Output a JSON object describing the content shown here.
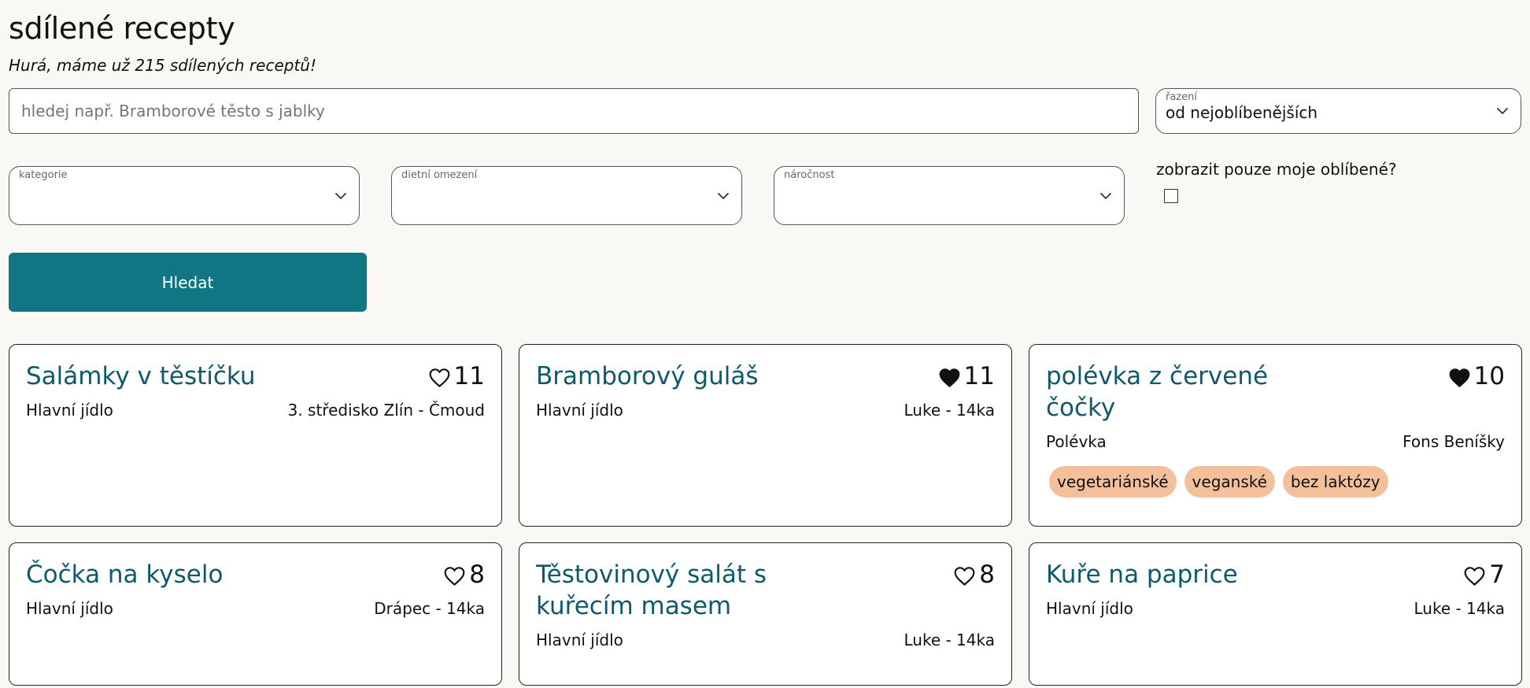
{
  "header": {
    "title": "sdílené recepty",
    "subtitle": "Hurá, máme už 215 sdílených receptů!"
  },
  "search": {
    "placeholder": "hledej např. Bramborové těsto s jablky",
    "value": ""
  },
  "sort": {
    "label": "řazení",
    "value": "od nejoblíbenějších"
  },
  "filters": {
    "category": {
      "label": "kategorie",
      "value": ""
    },
    "diet": {
      "label": "dietní omezení",
      "value": ""
    },
    "difficulty": {
      "label": "náročnost",
      "value": ""
    },
    "favorites_only": {
      "label": "zobrazit pouze moje oblíbené?",
      "checked": false
    }
  },
  "search_button": {
    "label": "Hledat"
  },
  "colors": {
    "accent": "#107684",
    "title": "#0e5a6c",
    "tag": "#f4c09c",
    "background": "#faf8f5"
  },
  "recipes": [
    {
      "title": "Salámky v těstíčku",
      "likes": "11",
      "liked": false,
      "category": "Hlavní jídlo",
      "author": "3. středisko Zlín - Čmoud",
      "tags": []
    },
    {
      "title": "Bramborový guláš",
      "likes": "11",
      "liked": true,
      "category": "Hlavní jídlo",
      "author": "Luke - 14ka",
      "tags": []
    },
    {
      "title": "polévka z červené čočky",
      "likes": "10",
      "liked": true,
      "category": "Polévka",
      "author": "Fons Beníšky",
      "tags": [
        "vegetariánské",
        "veganské",
        "bez laktózy"
      ]
    },
    {
      "title": "Čočka na kyselo",
      "likes": "8",
      "liked": false,
      "category": "Hlavní jídlo",
      "author": "Drápec - 14ka",
      "tags": []
    },
    {
      "title": "Těstovinový salát s kuřecím masem",
      "likes": "8",
      "liked": false,
      "category": "Hlavní jídlo",
      "author": "Luke - 14ka",
      "tags": []
    },
    {
      "title": "Kuře na paprice",
      "likes": "7",
      "liked": false,
      "category": "Hlavní jídlo",
      "author": "Luke - 14ka",
      "tags": []
    }
  ]
}
